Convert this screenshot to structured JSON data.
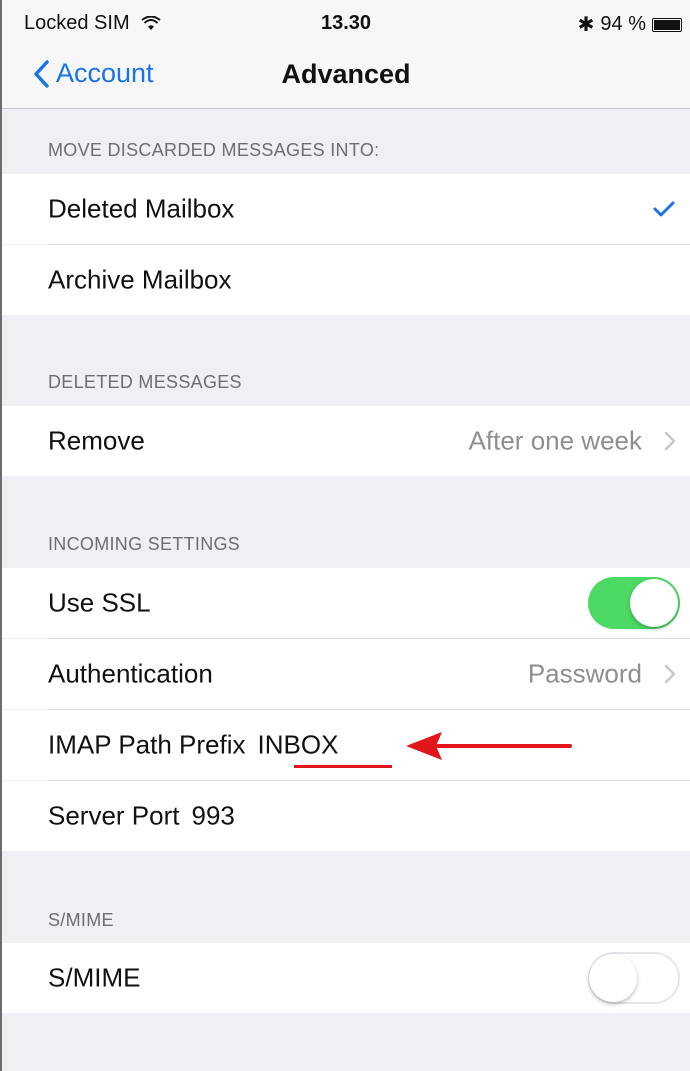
{
  "status_bar": {
    "carrier": "Locked SIM",
    "time": "13.30",
    "bluetooth": "✱",
    "battery": "94 %",
    "battery_level": 0.94
  },
  "nav": {
    "back_label": "Account",
    "title": "Advanced"
  },
  "sections": {
    "discard": {
      "header": "MOVE DISCARDED MESSAGES INTO:",
      "deleted_mailbox": "Deleted Mailbox",
      "archive_mailbox": "Archive Mailbox"
    },
    "deleted": {
      "header": "DELETED MESSAGES",
      "remove_label": "Remove",
      "remove_value": "After one week"
    },
    "incoming": {
      "header": "INCOMING SETTINGS",
      "use_ssl": "Use SSL",
      "authentication": "Authentication",
      "authentication_value": "Password",
      "imap_path_prefix": "IMAP Path Prefix",
      "imap_path_value": "INBOX",
      "server_port": "Server Port",
      "server_port_value": "993"
    },
    "smime": {
      "header": "S/MIME",
      "smime_label": "S/MIME"
    }
  },
  "colors": {
    "accent": "#1a73e8",
    "toggle_on": "#4cd964",
    "annotation": "#e0161b"
  }
}
